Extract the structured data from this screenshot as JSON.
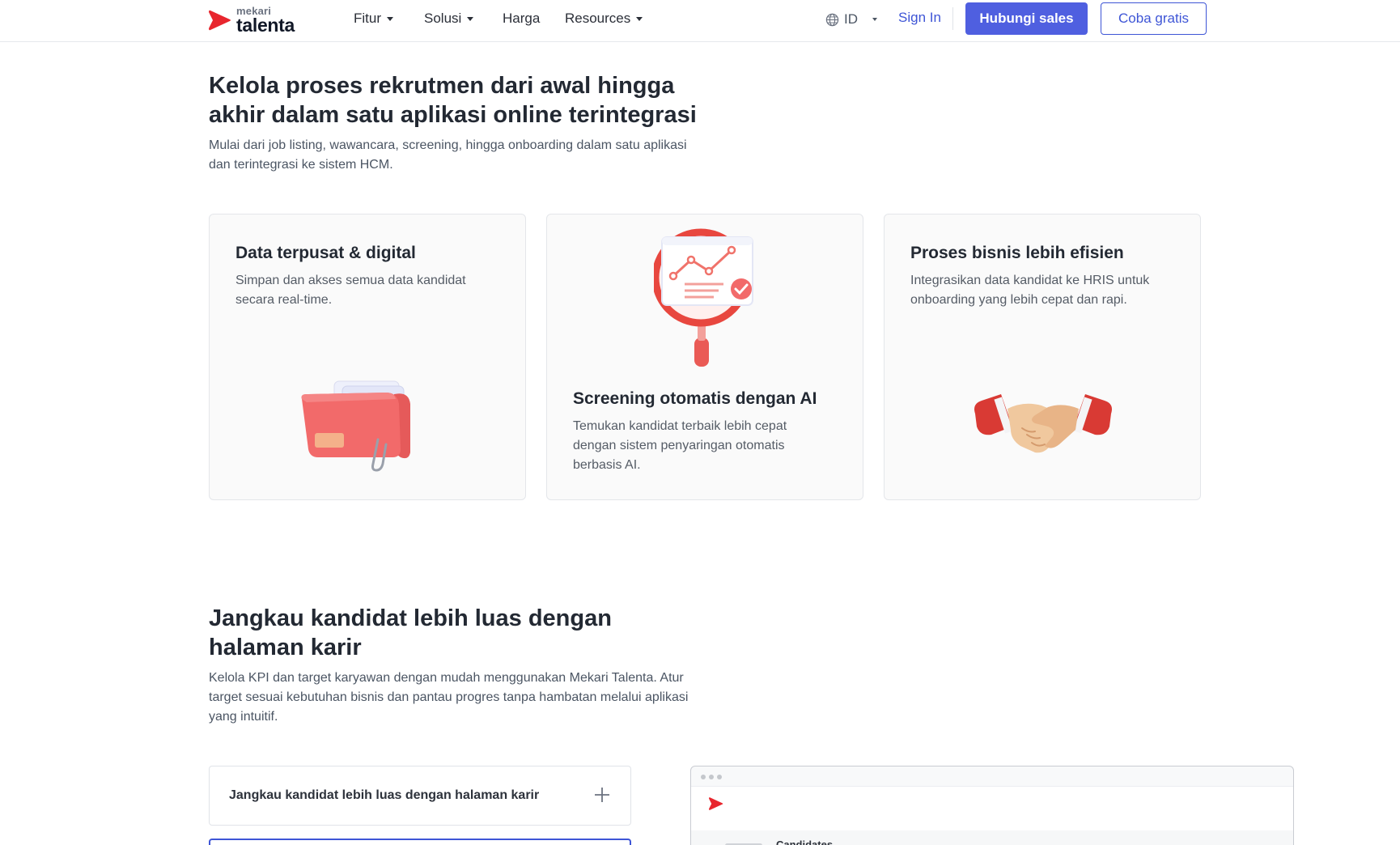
{
  "header": {
    "logo": {
      "small": "mekari",
      "big": "talenta",
      "brand_color": "#e8262e"
    },
    "nav": [
      {
        "label": "Fitur",
        "has_dropdown": true
      },
      {
        "label": "Solusi",
        "has_dropdown": true
      },
      {
        "label": "Harga",
        "has_dropdown": false
      },
      {
        "label": "Resources",
        "has_dropdown": true
      }
    ],
    "language": "ID",
    "signin_label": "Sign In",
    "sales_label": "Hubungi sales",
    "trial_label": "Coba gratis",
    "accent_color": "#4f5fe0"
  },
  "hero": {
    "title": "Kelola proses rekrutmen dari awal hingga akhir dalam satu aplikasi online terintegrasi",
    "subtitle": "Mulai dari job listing, wawancara, screening, hingga onboarding dalam satu aplikasi dan terintegrasi ke sistem HCM."
  },
  "cards": [
    {
      "title": "Data terpusat & digital",
      "desc": "Simpan dan akses semua data kandidat secara real-time.",
      "icon": "folder-icon"
    },
    {
      "title": "Screening otomatis dengan AI",
      "desc": "Temukan kandidat terbaik lebih cepat dengan sistem penyaringan otomatis berbasis AI.",
      "icon": "magnifier-chart-icon"
    },
    {
      "title": "Proses bisnis lebih efisien",
      "desc": "Integrasikan data kandidat ke HRIS untuk onboarding yang lebih cepat dan rapi.",
      "icon": "handshake-icon"
    }
  ],
  "section2": {
    "title": "Jangkau kandidat lebih luas dengan halaman karir",
    "subtitle": "Kelola KPI dan target karyawan dengan mudah menggunakan Mekari Talenta. Atur target sesuai kebutuhan bisnis dan pantau progres tanpa hambatan melalui aplikasi yang intuitif.",
    "accordion": [
      {
        "label": "Jangkau kandidat lebih luas dengan halaman karir",
        "expanded": false
      }
    ],
    "preview": {
      "label": "Candidates"
    }
  }
}
